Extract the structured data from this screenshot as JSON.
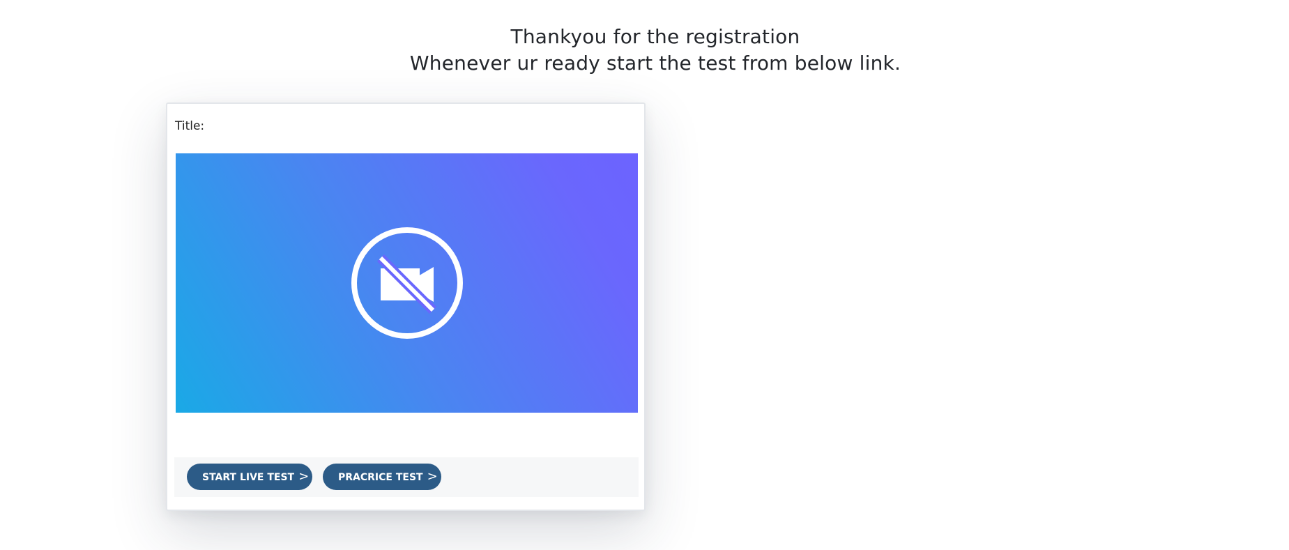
{
  "heading": {
    "line1": "Thankyou for the registration",
    "line2": "Whenever ur ready start the test from below link."
  },
  "card": {
    "title_label": "Title:",
    "video": {
      "icon": "video-off-icon",
      "gradient_colors": [
        "#1aa9e6",
        "#6c63ff"
      ]
    },
    "buttons": {
      "start_live_label": "START LIVE TEST",
      "practice_label": "PRACRICE TEST",
      "chevron": ">"
    },
    "button_color": "#2c5b87"
  }
}
